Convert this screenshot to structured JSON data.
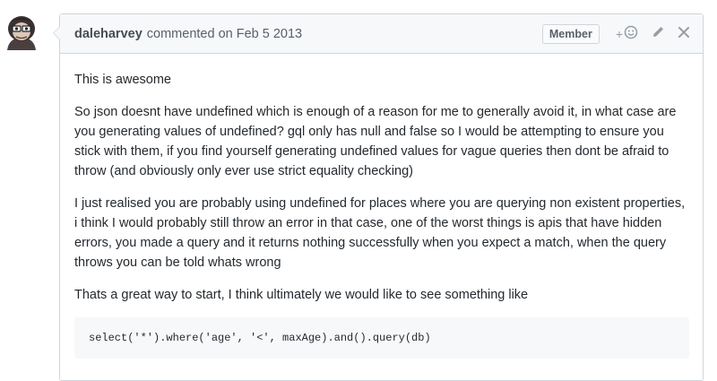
{
  "comment": {
    "author": "daleharvey",
    "meta": "commented on Feb 5 2013",
    "badge": "Member",
    "reaction_plus": "+",
    "paragraphs": [
      "This is awesome",
      "So json doesnt have undefined which is enough of a reason for me to generally avoid it, in what case are you generating values of undefined? gql only has null and false so I would be attempting to ensure you stick with them, if you find yourself generating undefined values for vague queries then dont be afraid to throw (and obviously only ever use strict equality checking)",
      "I just realised you are probably using undefined for places where you are querying non existent properties, i think I would probably still throw an error in that case, one of the worst things is apis that have hidden errors, you made a query and it returns nothing successfully when you expect a match, when the query throws you can be told whats wrong",
      "Thats a great way to start, I think ultimately we would like to see something like"
    ],
    "code": "select('*').where('age', '<', maxAge).and().query(db)"
  },
  "icons": {
    "avatar": "avatar-image",
    "reaction": "smiley-icon",
    "edit": "pencil-icon",
    "delete": "close-icon"
  }
}
